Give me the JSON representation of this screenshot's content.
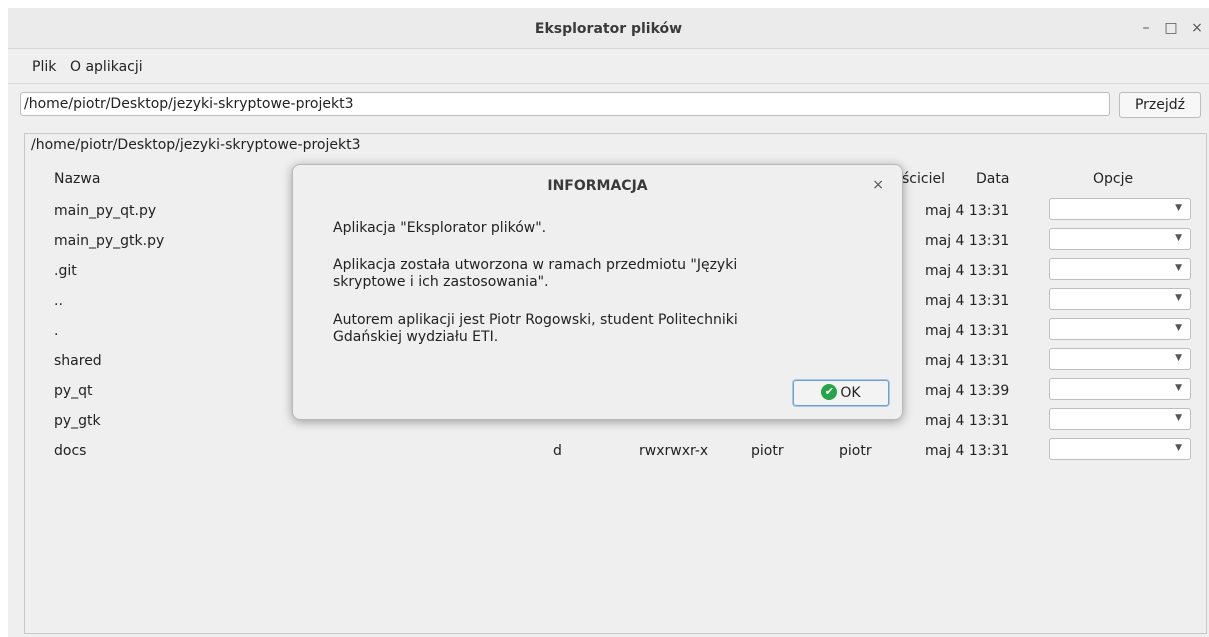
{
  "window": {
    "title": "Eksplorator plików",
    "minimize_glyph": "–",
    "maximize_glyph": "□",
    "close_glyph": "×"
  },
  "menubar": {
    "items": [
      {
        "label": "Plik"
      },
      {
        "label": "O aplikacji"
      }
    ]
  },
  "path_bar": {
    "value": "/home/piotr/Desktop/jezyki-skryptowe-projekt3",
    "go_label": "Przejdź"
  },
  "panel": {
    "title": "/home/piotr/Desktop/jezyki-skryptowe-projekt3",
    "columns": {
      "name": "Nazwa",
      "owner": "ściciel",
      "date": "Data",
      "options": "Opcje"
    },
    "rows": [
      {
        "name": "main_py_qt.py",
        "type": "",
        "perms": "",
        "owner": "",
        "group": "",
        "date": "maj 4 13:31"
      },
      {
        "name": "main_py_gtk.py",
        "type": "",
        "perms": "",
        "owner": "",
        "group": "",
        "date": "maj 4 13:31"
      },
      {
        "name": ".git",
        "type": "",
        "perms": "",
        "owner": "",
        "group": "",
        "date": "maj 4 13:31"
      },
      {
        "name": "..",
        "type": "",
        "perms": "",
        "owner": "",
        "group": "",
        "date": "maj 4 13:31"
      },
      {
        "name": ".",
        "type": "",
        "perms": "",
        "owner": "",
        "group": "",
        "date": "maj 4 13:31"
      },
      {
        "name": "shared",
        "type": "",
        "perms": "",
        "owner": "",
        "group": "",
        "date": "maj 4 13:31"
      },
      {
        "name": "py_qt",
        "type": "",
        "perms": "",
        "owner": "",
        "group": "",
        "date": "maj 4 13:39"
      },
      {
        "name": "py_gtk",
        "type": "",
        "perms": "",
        "owner": "",
        "group": "",
        "date": "maj 4 13:31"
      },
      {
        "name": "docs",
        "type": "d",
        "perms": "rwxrwxr-x",
        "owner": "piotr",
        "group": "piotr",
        "date": "maj 4 13:31"
      }
    ]
  },
  "dialog": {
    "title": "INFORMACJA",
    "close_glyph": "×",
    "line1": "Aplikacja \"Eksplorator plików\".",
    "line2a": "Aplikacja została utworzona w ramach przedmiotu \"Języki",
    "line2b": "skryptowe i ich zastosowania\".",
    "line3a": "Autorem aplikacji jest Piotr Rogowski, student Politechniki",
    "line3b": "Gdańskiej wydziału ETI.",
    "ok_label": "OK",
    "ok_icon_glyph": "✔"
  },
  "colors": {
    "window_bg": "#efefef",
    "ok_icon": "#27a34a",
    "focus_border": "#6f9fd0"
  }
}
